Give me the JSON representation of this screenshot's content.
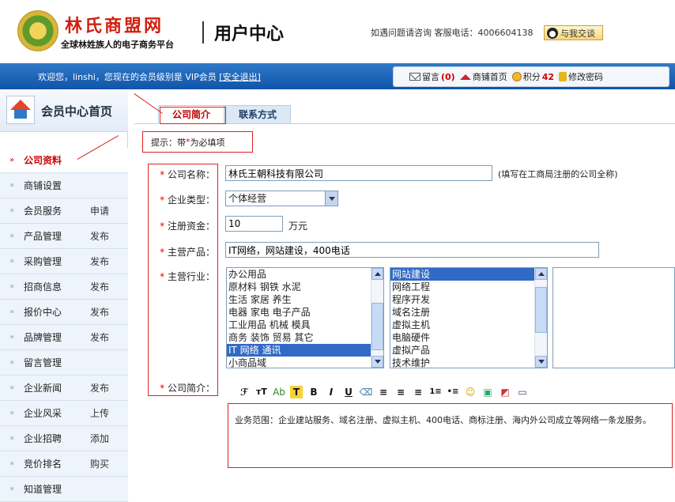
{
  "header": {
    "brand": "林氏商盟网",
    "slogan": "全球林姓族人的电子商务平台",
    "center_title": "用户中心",
    "contact": "如遇问题请咨询 客服电话：4006604138",
    "qq_button": "与我交谈"
  },
  "navbar": {
    "welcome": "欢迎您，linshi，您现在的会员级别是 VIP会员 ",
    "logout": "[安全退出]",
    "links": {
      "message_label": "留言",
      "message_count": "(0)",
      "shop_home": "商铺首页",
      "points_label": "积分",
      "points_value": "42",
      "change_password": "修改密码"
    }
  },
  "sidebar": {
    "title": "会员中心首页",
    "items": [
      {
        "label": "公司资料",
        "action": ""
      },
      {
        "label": "商铺设置",
        "action": ""
      },
      {
        "label": "会员服务",
        "action": "申请"
      },
      {
        "label": "产品管理",
        "action": "发布"
      },
      {
        "label": "采购管理",
        "action": "发布"
      },
      {
        "label": "招商信息",
        "action": "发布"
      },
      {
        "label": "报价中心",
        "action": "发布"
      },
      {
        "label": "品牌管理",
        "action": "发布"
      },
      {
        "label": "留言管理",
        "action": ""
      },
      {
        "label": "企业新闻",
        "action": "发布"
      },
      {
        "label": "企业风采",
        "action": "上传"
      },
      {
        "label": "企业招聘",
        "action": "添加"
      },
      {
        "label": "竞价排名",
        "action": "购买"
      },
      {
        "label": "知道管理",
        "action": ""
      }
    ]
  },
  "tabs": [
    "公司简介",
    "联系方式"
  ],
  "hint": {
    "prefix": "提示：带 ",
    "star": "*",
    "suffix": " 为必填项"
  },
  "form": {
    "company_name": {
      "label": "公司名称：",
      "value": "林氏王朝科技有限公司",
      "note": "(填写在工商局注册的公司全称)"
    },
    "company_type": {
      "label": "企业类型：",
      "value": "个体经营"
    },
    "capital": {
      "label": "注册资金：",
      "value": "10",
      "unit": "万元"
    },
    "products": {
      "label": "主营产品：",
      "value": "IT网络，网站建设，400电话"
    },
    "industry": {
      "label": "主营行业：",
      "list1": [
        "办公用品",
        "原材料 钢铁 水泥",
        "生活 家居 养生",
        "电器 家电 电子产品",
        "工业用品 机械 模具",
        "商务 装饰 贸易 其它",
        "IT 网络 通讯",
        "小商品域"
      ],
      "list1_selected": "IT 网络 通讯",
      "list2": [
        "网站建设",
        "网络工程",
        "程序开发",
        "域名注册",
        "虚拟主机",
        "电脑硬件",
        "虚拟产品",
        "技术维护"
      ],
      "list2_selected": "网站建设"
    },
    "intro": {
      "label": "公司简介：",
      "value": "业务范围：企业建站服务、域名注册、虚拟主机、400电话、商标注册、海内外公司成立等网络一条龙服务。"
    }
  },
  "editor_toolbar": [
    "font-icon",
    "font-size-icon",
    "text-color-icon",
    "highlight-icon",
    "bold-icon",
    "italic-icon",
    "underline-icon",
    "eraser-icon",
    "align-left-icon",
    "align-center-icon",
    "align-right-icon",
    "ordered-list-icon",
    "unordered-list-icon",
    "emoticon-icon",
    "image-icon",
    "flash-icon",
    "media-icon"
  ],
  "colors": {
    "nav_blue": "#1154a8",
    "accent_red": "#d20000",
    "sidebar_bg": "#eef4fb"
  }
}
